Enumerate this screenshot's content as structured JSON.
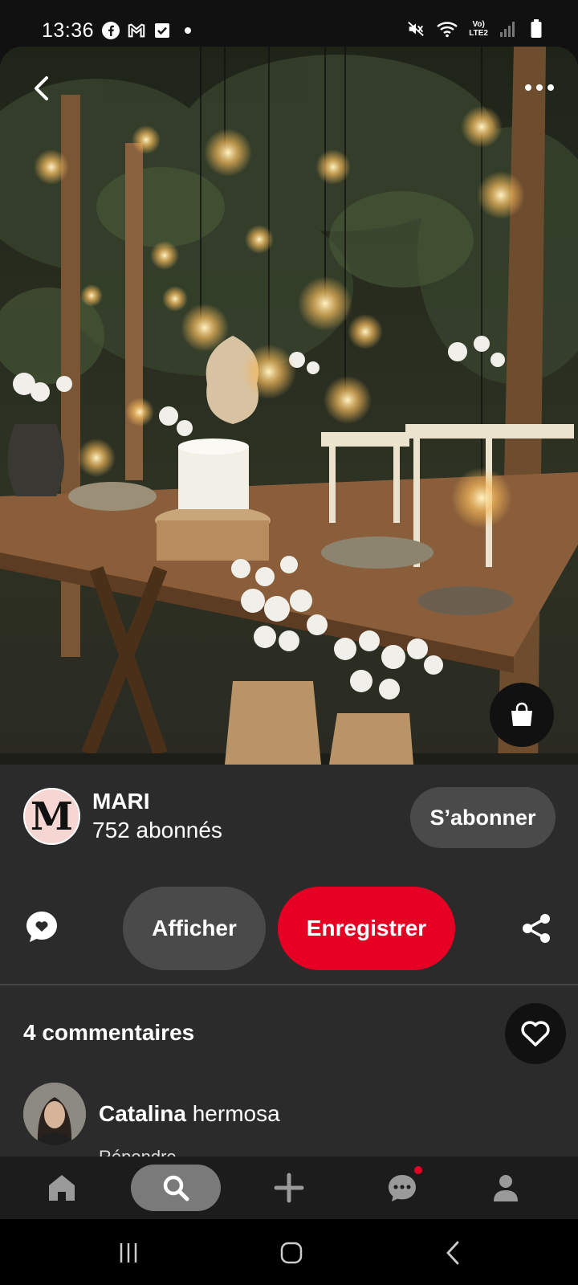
{
  "status_bar": {
    "time": "13:36",
    "left_icons": [
      "facebook-icon",
      "gmail-icon",
      "checkbox-icon"
    ],
    "right_icons": [
      "mute-icon",
      "wifi-icon",
      "signal-icon",
      "battery-icon"
    ],
    "lte_line1": "Vo)",
    "lte_line2": "LTE2"
  },
  "pin": {
    "image_icon_back": "chevron-left-icon",
    "image_icon_more": "more-icon",
    "shop_icon": "shopping-bag-icon"
  },
  "creator": {
    "avatar_letter": "M",
    "name": "MARI",
    "followers": "752 abonnés",
    "subscribe_label": "S’abonner"
  },
  "actions": {
    "view_label": "Afficher",
    "save_label": "Enregistrer",
    "save_color": "#e60023"
  },
  "comments": {
    "title": "4 commentaires",
    "items": [
      {
        "author": "Catalina",
        "text": "hermosa",
        "meta": "Répondre"
      }
    ]
  },
  "bottom_nav": {
    "items": [
      "home-icon",
      "search-icon",
      "plus-icon",
      "chat-icon",
      "profile-icon"
    ],
    "active": "search-icon"
  },
  "system_nav": [
    "recents-icon",
    "home-circle-icon",
    "back-icon"
  ]
}
